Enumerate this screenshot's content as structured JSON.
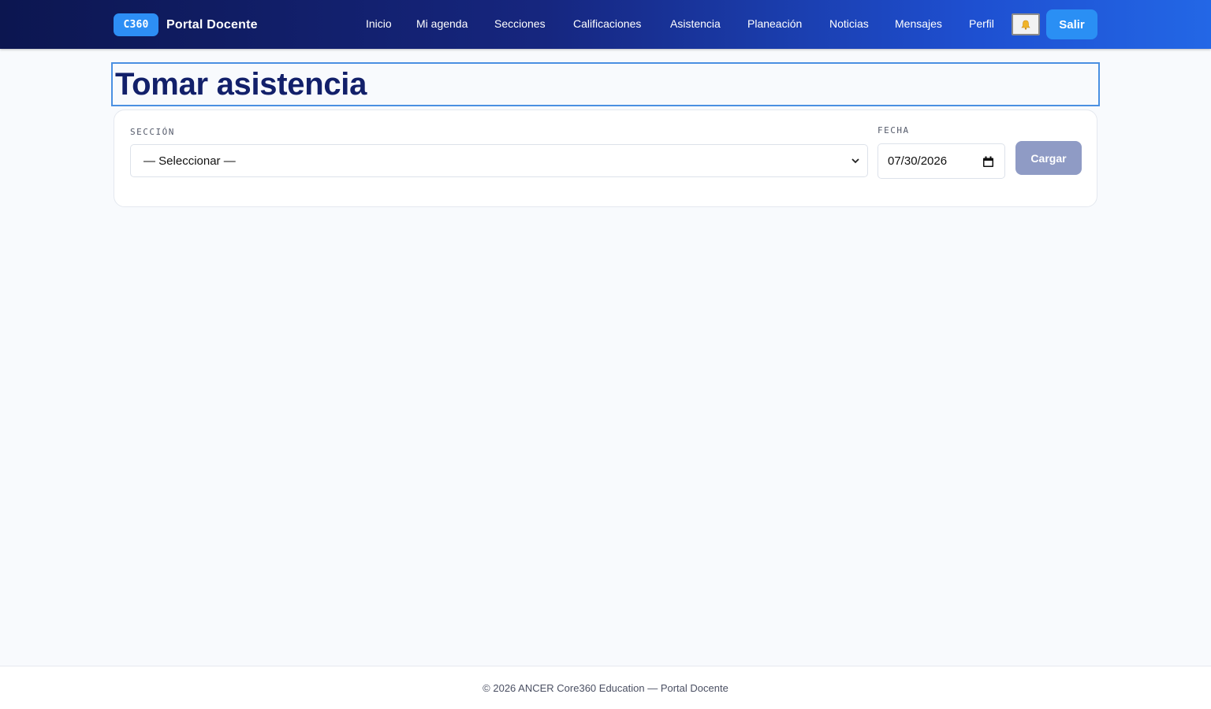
{
  "header": {
    "logo_text": "C360",
    "brand_name": "Portal Docente",
    "nav": [
      {
        "label": "Inicio"
      },
      {
        "label": "Mi agenda"
      },
      {
        "label": "Secciones"
      },
      {
        "label": "Calificaciones"
      },
      {
        "label": "Asistencia"
      },
      {
        "label": "Planeación"
      },
      {
        "label": "Noticias"
      },
      {
        "label": "Mensajes"
      },
      {
        "label": "Perfil"
      }
    ],
    "notifications_icon": "bell-icon",
    "logout_label": "Salir"
  },
  "page": {
    "title": "Tomar asistencia"
  },
  "form": {
    "section_label": "SECCIÓN",
    "section_value": "— Seleccionar —",
    "date_label": "FECHA",
    "date_value": "07/30/2026",
    "load_label": "Cargar"
  },
  "footer": {
    "text": "© 2026 ANCER Core360 Education — Portal Docente"
  },
  "colors": {
    "nav_gradient_start": "#0c1650",
    "nav_gradient_end": "#2367e6",
    "accent": "#2a8ff4",
    "title": "#12206a",
    "load_button_disabled": "#8f9bc5"
  }
}
